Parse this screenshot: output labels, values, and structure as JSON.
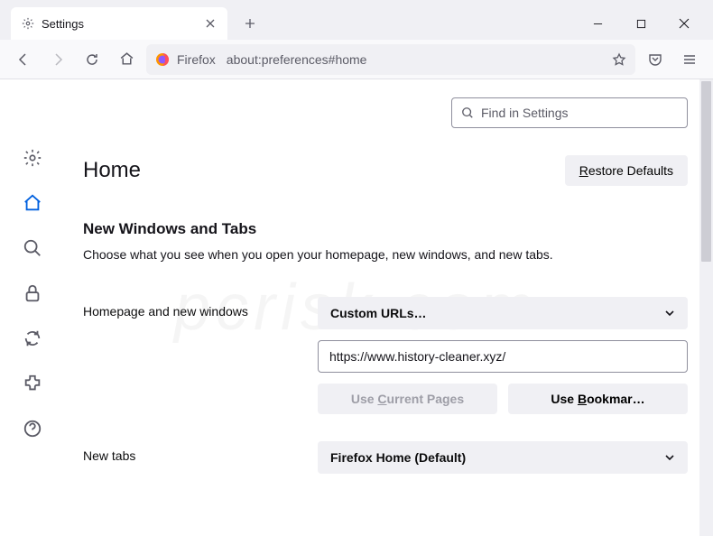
{
  "tab": {
    "title": "Settings"
  },
  "urlbar": {
    "identity": "Firefox",
    "url": "about:preferences#home"
  },
  "search": {
    "placeholder": "Find in Settings"
  },
  "page": {
    "title": "Home",
    "restore": "Restore Defaults",
    "restore_u": "R",
    "section_title": "New Windows and Tabs",
    "section_desc": "Choose what you see when you open your homepage, new windows, and new tabs."
  },
  "homepage": {
    "label": "Homepage and new windows",
    "select_value": "Custom URLs…",
    "input_value": "https://www.history-cleaner.xyz/",
    "use_current": "Use Current Pages",
    "use_current_u": "C",
    "use_bookmark": "Use Bookmar…",
    "use_bookmark_u": "B"
  },
  "newtabs": {
    "label": "New tabs",
    "select_value": "Firefox Home (Default)"
  },
  "watermark": "pcrisk.com"
}
